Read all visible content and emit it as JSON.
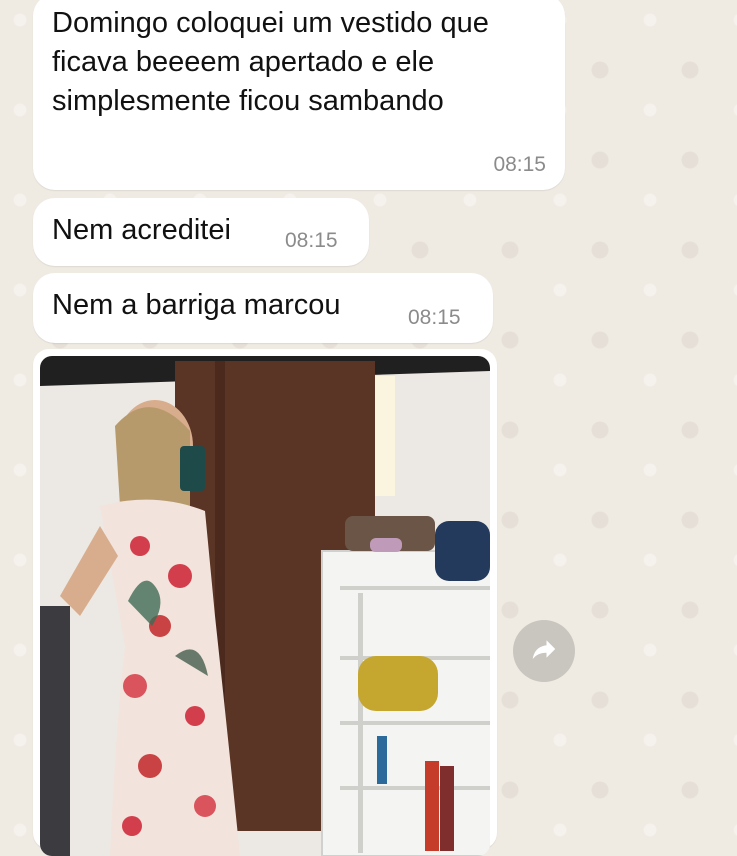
{
  "chat": {
    "messages": [
      {
        "text": "Domingo coloquei um vestido que ficava beeeem apertado e ele simplesmente ficou sambando",
        "time": "08:15"
      },
      {
        "text": "Nem acreditei",
        "time": "08:15"
      },
      {
        "text": "Nem a barriga marcou",
        "time": "08:15"
      }
    ],
    "photo_icon": "photo-image",
    "forward_icon": "forward-arrow-icon"
  },
  "colors": {
    "background": "#efeae2",
    "bubble": "#ffffff",
    "timestamp": "#8b8b8b"
  }
}
